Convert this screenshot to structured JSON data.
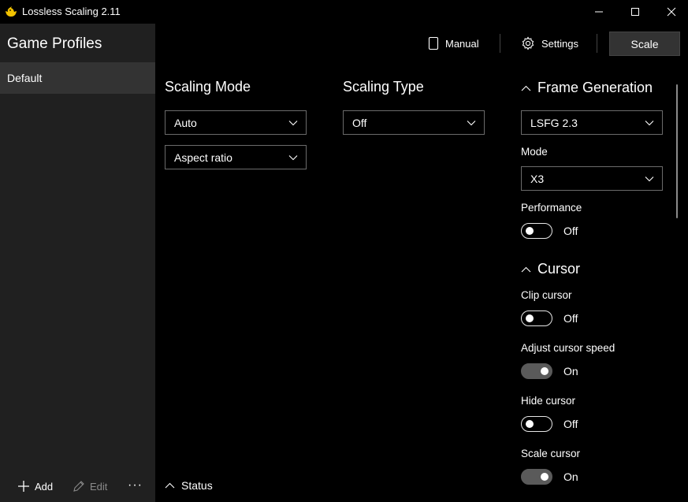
{
  "window": {
    "title": "Lossless Scaling 2.11",
    "controls": [
      "minimize",
      "maximize",
      "close"
    ]
  },
  "header": {
    "title": "Game Profiles",
    "manual_label": "Manual",
    "settings_label": "Settings",
    "scale_label": "Scale"
  },
  "sidebar": {
    "profiles": [
      {
        "label": "Default",
        "selected": true
      }
    ],
    "add_label": "Add",
    "edit_label": "Edit",
    "more_label": "···"
  },
  "scaling_mode": {
    "title": "Scaling Mode",
    "mode_value": "Auto",
    "ratio_value": "Aspect ratio"
  },
  "scaling_type": {
    "title": "Scaling Type",
    "value": "Off"
  },
  "frame_generation": {
    "title": "Frame Generation",
    "value": "LSFG 2.3",
    "mode_label": "Mode",
    "mode_value": "X3",
    "performance_label": "Performance",
    "performance_state": "Off"
  },
  "cursor": {
    "title": "Cursor",
    "clip_label": "Clip cursor",
    "clip_state": "Off",
    "adjust_label": "Adjust cursor speed",
    "adjust_state": "On",
    "hide_label": "Hide cursor",
    "hide_state": "Off",
    "scale_label": "Scale cursor",
    "scale_state": "On"
  },
  "status": {
    "label": "Status"
  },
  "colors": {
    "background": "#000000",
    "sidebar": "#202020",
    "selected": "#333333",
    "border": "#6b6b6b"
  }
}
